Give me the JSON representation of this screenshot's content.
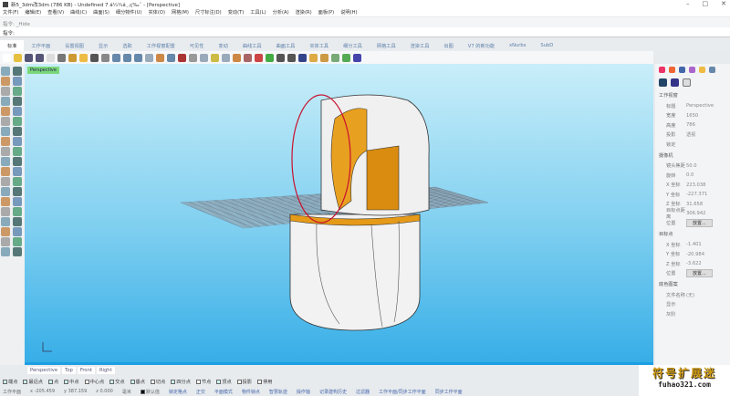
{
  "title": "新5_3dm改3dm (786 KB) - Undefined 7 á¼¼á¸‚ç‰ˆ - [Perspective]",
  "menu": [
    "文件(F)",
    "编辑(E)",
    "查看(V)",
    "曲线(C)",
    "曲面(S)",
    "细分物件(U)",
    "实体(O)",
    "网格(M)",
    "尺寸标注(D)",
    "变动(T)",
    "工具(L)",
    "分析(A)",
    "渲染(R)",
    "面板(P)",
    "说明(H)"
  ],
  "command": {
    "history": "指令: _Hide",
    "prompt": "指令:"
  },
  "tabs": [
    "标准",
    "工作平面",
    "设置视图",
    "显示",
    "选取",
    "工作视窗配置",
    "可见性",
    "变动",
    "曲线工具",
    "曲面工具",
    "实体工具",
    "细分工具",
    "网格工具",
    "渲染工具",
    "出图",
    "V7 的新功能",
    "xNurbs",
    "SubD"
  ],
  "viewport": {
    "label": "Perspective"
  },
  "view_tabs": [
    "Perspective",
    "Top",
    "Front",
    "Right"
  ],
  "osnaps": [
    {
      "label": "端点",
      "on": true
    },
    {
      "label": "最近点",
      "on": true
    },
    {
      "label": "点",
      "on": true
    },
    {
      "label": "中点",
      "on": true
    },
    {
      "label": "中心点",
      "on": false
    },
    {
      "label": "交点",
      "on": true
    },
    {
      "label": "垂点",
      "on": true
    },
    {
      "label": "切点",
      "on": false
    },
    {
      "label": "四分点",
      "on": true
    },
    {
      "label": "节点",
      "on": false
    },
    {
      "label": "顶点",
      "on": true
    },
    {
      "label": "投影",
      "on": false
    },
    {
      "label": "停用",
      "on": false
    }
  ],
  "status": {
    "cplane": "工作平面",
    "x": "x -205.459",
    "y": "y 387.159",
    "z": "z 0.000",
    "units": "毫米",
    "layer": "默认值",
    "toggles": [
      "锁定格点",
      "正交",
      "平面模式",
      "物件锁点",
      "智慧轨迹",
      "操作轴",
      "记录建构历史",
      "过滤器",
      "工作平面/同步工作平面",
      "同步工作平面"
    ]
  },
  "panel": {
    "viewport_section": "工作视窗",
    "viewport_rows": [
      {
        "k": "标题",
        "v": "Perspective"
      },
      {
        "k": "宽度",
        "v": "1650"
      },
      {
        "k": "高度",
        "v": "786"
      },
      {
        "k": "投影",
        "v": "透视"
      },
      {
        "k": "锁定",
        "v": ""
      }
    ],
    "camera_section": "摄像机",
    "camera_rows": [
      {
        "k": "镜头焦距",
        "v": "50.0"
      },
      {
        "k": "旋转",
        "v": "0.0"
      },
      {
        "k": "X 坐标",
        "v": "223.038"
      },
      {
        "k": "Y 坐标",
        "v": "-227.371"
      },
      {
        "k": "Z 坐标",
        "v": "31.658"
      },
      {
        "k": "目标点距离",
        "v": "306.942"
      }
    ],
    "position_label": "位置",
    "place_button": "放置...",
    "target_section": "目标点",
    "target_rows": [
      {
        "k": "X 坐标",
        "v": "-1.401"
      },
      {
        "k": "Y 坐标",
        "v": "-20.984"
      },
      {
        "k": "Z 坐标",
        "v": "-3.622"
      }
    ],
    "wallpaper_section": "底色图案",
    "wallpaper_rows": [
      {
        "k": "文件名称",
        "v": "(无)"
      },
      {
        "k": "显示",
        "v": ""
      },
      {
        "k": "灰阶",
        "v": ""
      }
    ]
  },
  "watermark": {
    "line1": "符号扩展迷",
    "line2": "fuhao321.com"
  }
}
